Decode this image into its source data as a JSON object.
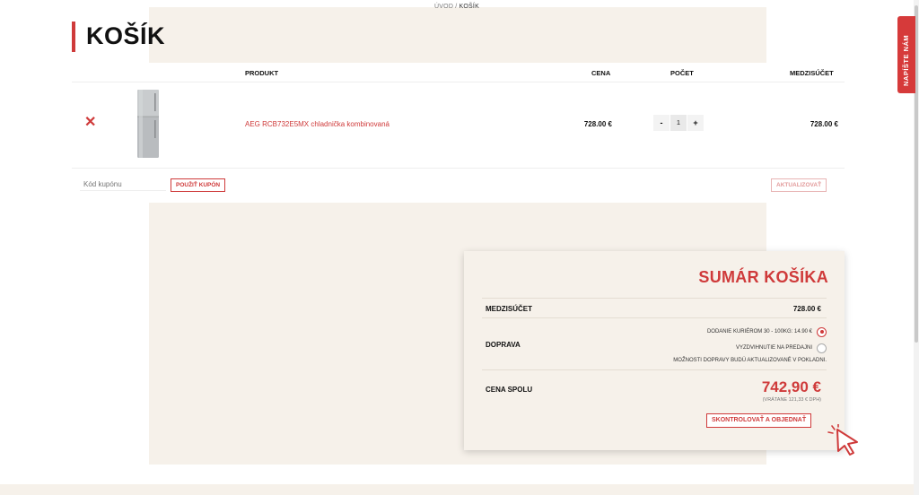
{
  "breadcrumb": {
    "home": "ÚVOD",
    "separator": "/",
    "current": "KOŠÍK"
  },
  "page_title": "KOŠÍK",
  "side_tab": {
    "label": "NAPÍŠTE NÁM"
  },
  "cart": {
    "headers": {
      "product": "PRODUKT",
      "price": "CENA",
      "quantity": "POČET",
      "subtotal": "MEDZISÚČET"
    },
    "items": [
      {
        "remove_icon": "close-icon",
        "name": "AEG RCB732E5MX chladnička kombinovaná",
        "price": "728.00 €",
        "quantity": "1",
        "subtotal": "728.00 €"
      }
    ],
    "qty_minus": "-",
    "qty_plus": "+",
    "coupon_placeholder": "Kód kupónu",
    "coupon_button": "POUŽIŤ KUPÓN",
    "update_button": "AKTUALIZOVAŤ"
  },
  "summary": {
    "title": "SUMÁR KOŠÍKA",
    "subtotal_label": "MEDZISÚČET",
    "subtotal_value": "728.00 €",
    "shipping_label": "DOPRAVA",
    "shipping_options": [
      {
        "label": "DODANIE KURIÉROM 30 - 100KG: 14.90 €",
        "selected": true
      },
      {
        "label": "VYZDVIHNUTIE NA PREDAJNI",
        "selected": false
      }
    ],
    "shipping_note": "MOŽNOSTI DOPRAVY BUDÚ AKTUALIZOVANÉ V POKLADNI.",
    "total_label": "CENA SPOLU",
    "total_value": "742,90 €",
    "vat_note": "(VRÁTANE 121,33 € DPH)",
    "checkout_button": "SKONTROLOVAŤ A OBJEDNAŤ"
  },
  "colors": {
    "accent": "#cf3a3a",
    "panel_bg": "#f6f1ea"
  }
}
